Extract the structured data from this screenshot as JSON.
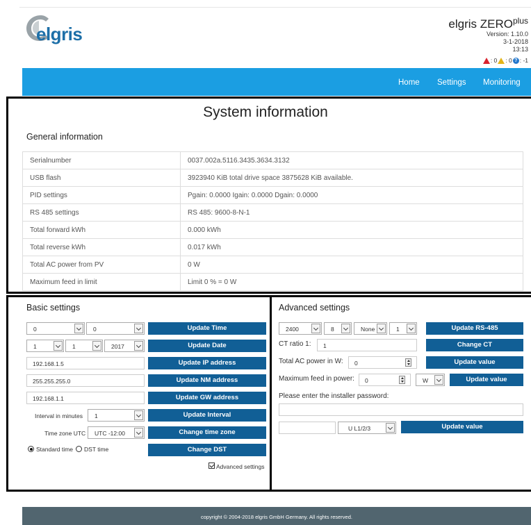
{
  "header": {
    "logo_text": "elgris",
    "brand": "elgris ZERO",
    "brand_sup": "plus",
    "version": "Version: 1.10.0",
    "date": "3-1-2018",
    "time": "13:13",
    "alerts": {
      "errors": ": 0",
      "warnings": ": 0",
      "info": ": -1"
    }
  },
  "nav": {
    "home": "Home",
    "settings": "Settings",
    "monitoring": "Monitoring"
  },
  "system": {
    "title": "System information",
    "general_title": "General information",
    "rows": [
      {
        "key": "Serialnumber",
        "value": "0037.002a.5116.3435.3634.3132"
      },
      {
        "key": "USB flash",
        "value": "3923940 KiB total drive space 3875628 KiB available."
      },
      {
        "key": "PID settings",
        "value": "Pgain: 0.0000 Igain: 0.0000 Dgain: 0.0000"
      },
      {
        "key": "RS 485 settings",
        "value": "RS 485: 9600-8-N-1"
      },
      {
        "key": "Total forward kWh",
        "value": "0.000 kWh"
      },
      {
        "key": "Total reverse kWh",
        "value": "0.017 kWh"
      },
      {
        "key": "Total AC power from PV",
        "value": "0 W"
      },
      {
        "key": "Maximum feed in limit",
        "value": "Limit 0 % = 0 W"
      }
    ]
  },
  "basic": {
    "title": "Basic settings",
    "hour": "0",
    "minute": "0",
    "day": "1",
    "month": "1",
    "year": "2017",
    "ip": "192.168.1.5",
    "netmask": "255.255.255.0",
    "gateway": "192.168.1.1",
    "interval_label": "Interval in minutes",
    "interval_value": "1",
    "timezone_label": "Time zone UTC",
    "timezone_value": "UTC -12:00",
    "standard_time": "Standard time",
    "dst_time": "DST time",
    "advanced_toggle": "Advanced settings",
    "buttons": {
      "time": "Update Time",
      "date": "Update Date",
      "ip": "Update IP address",
      "nm": "Update NM address",
      "gw": "Update GW address",
      "interval": "Update Interval",
      "timezone": "Change time zone",
      "dst": "Change DST"
    }
  },
  "advanced": {
    "title": "Advanced settings",
    "baud": "2400",
    "databits": "8",
    "parity": "None",
    "stopbits": "1",
    "rs485_button": "Update RS-485",
    "ct_label": "CT ratio 1:",
    "ct_value": "1",
    "ct_button": "Change CT",
    "ac_label": "Total AC power in W:",
    "ac_value": "0",
    "ac_button": "Update value",
    "feed_label": "Maximum feed in power:",
    "feed_value": "0",
    "feed_unit": "W",
    "feed_button": "Update value",
    "password_label": "Please enter the installer password:",
    "password_value": "",
    "installer_value": "",
    "phase_value": "U L1/2/3",
    "phase_button": "Update value"
  },
  "footer": {
    "copyright": "copyright © 2004-2018 elgris GmbH Germany. All rights reserved."
  },
  "colors": {
    "nav": "#1b9ee2",
    "button": "#115f96",
    "footer": "#51656f"
  },
  "icons": {
    "logo": "elgris-logo",
    "error": "error-triangle-icon",
    "warning": "warning-triangle-icon",
    "info": "info-icon"
  }
}
